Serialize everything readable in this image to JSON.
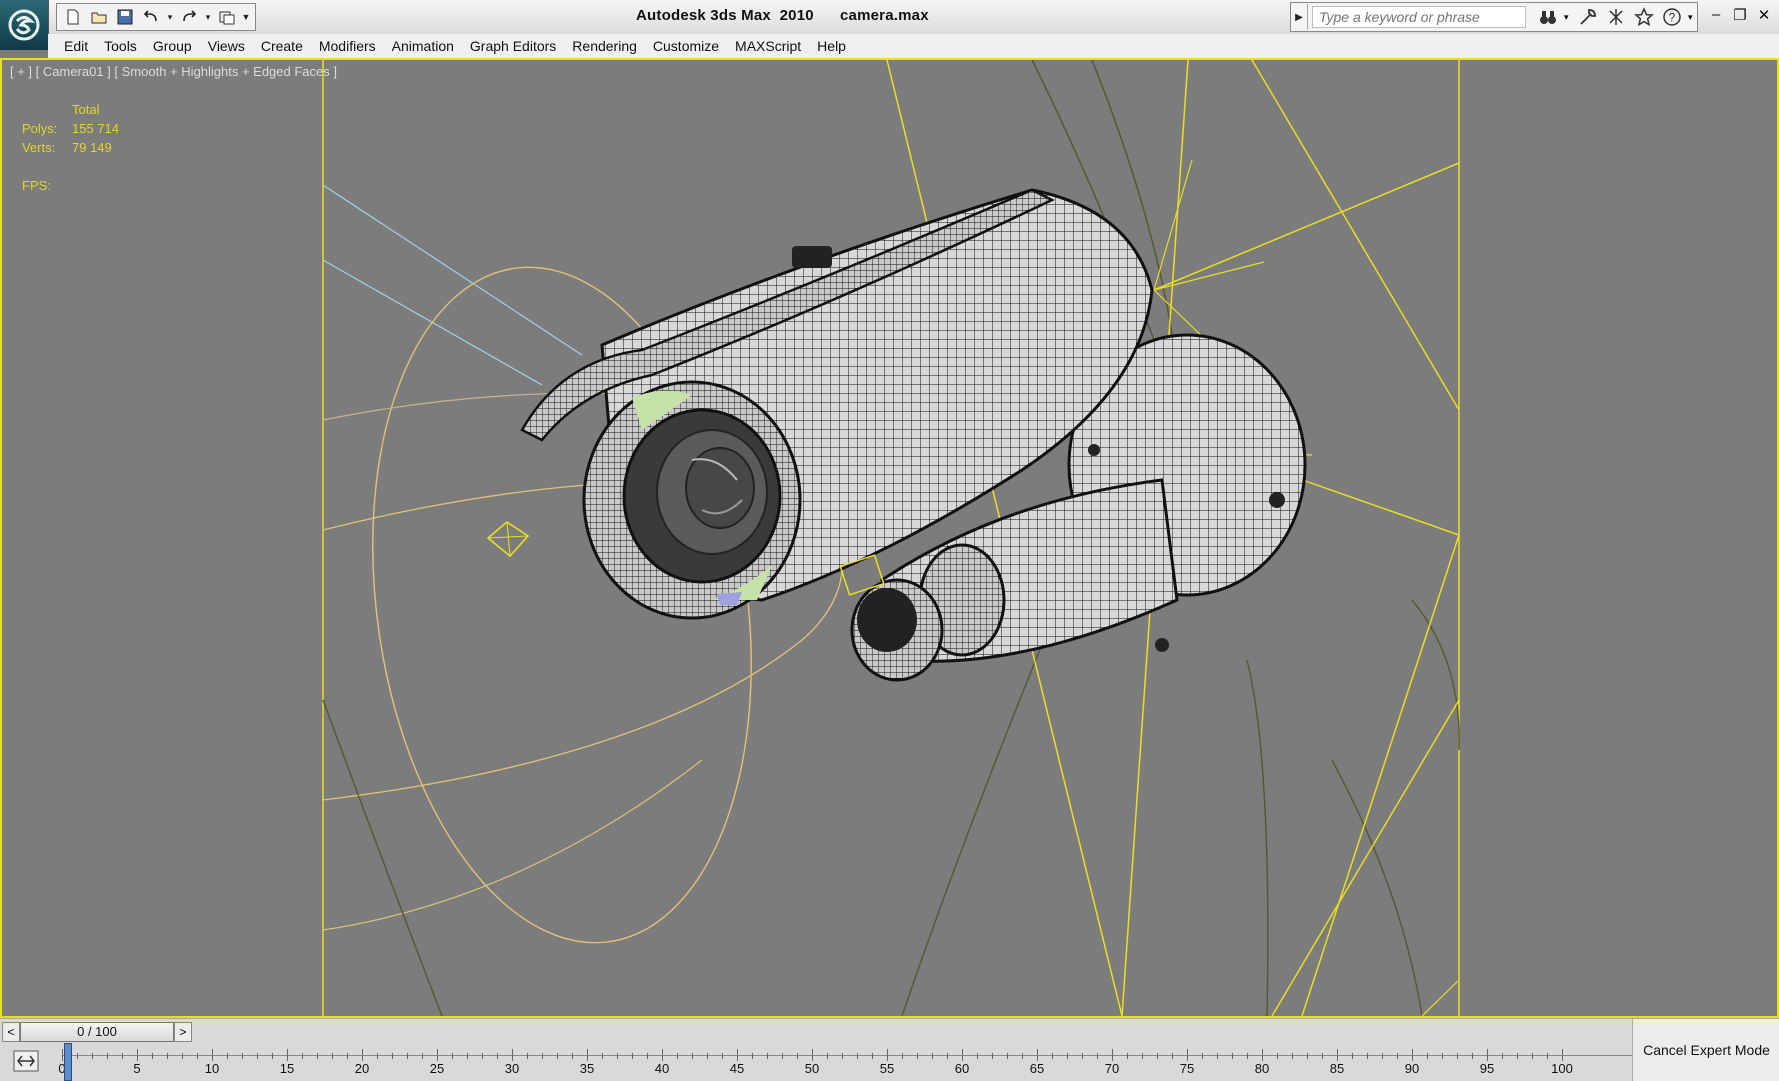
{
  "window": {
    "title": "Autodesk 3ds Max  2010      camera.max",
    "controls": [
      "–",
      "❐",
      "✕"
    ]
  },
  "search": {
    "placeholder": "Type a keyword or phrase"
  },
  "quick_access": [
    "new-file-icon",
    "open-folder-icon",
    "save-icon",
    "undo-icon",
    "redo-icon",
    "project-folder-icon"
  ],
  "menu": [
    "Edit",
    "Tools",
    "Group",
    "Views",
    "Create",
    "Modifiers",
    "Animation",
    "Graph Editors",
    "Rendering",
    "Customize",
    "MAXScript",
    "Help"
  ],
  "viewport": {
    "label": "[ + ] [ Camera01 ] [ Smooth + Highlights + Edged Faces ]",
    "stats": {
      "header": "Total",
      "polys_label": "Polys:",
      "polys_value": "155 714",
      "verts_label": "Verts:",
      "verts_value": "79 149",
      "fps_label": "FPS:"
    }
  },
  "timeline": {
    "prev": "<",
    "next": ">",
    "slider": "0 / 100",
    "ticks": [
      "0",
      "5",
      "10",
      "15",
      "20",
      "25",
      "30",
      "35",
      "40",
      "45",
      "50",
      "55",
      "60",
      "65",
      "70",
      "75",
      "80",
      "85",
      "90",
      "95",
      "100"
    ],
    "expert_button": "Cancel Expert Mode"
  },
  "colors": {
    "viewport_border": "#e8de24",
    "stats_text": "#e3d52a",
    "viewport_bg": "#7c7c7c"
  }
}
